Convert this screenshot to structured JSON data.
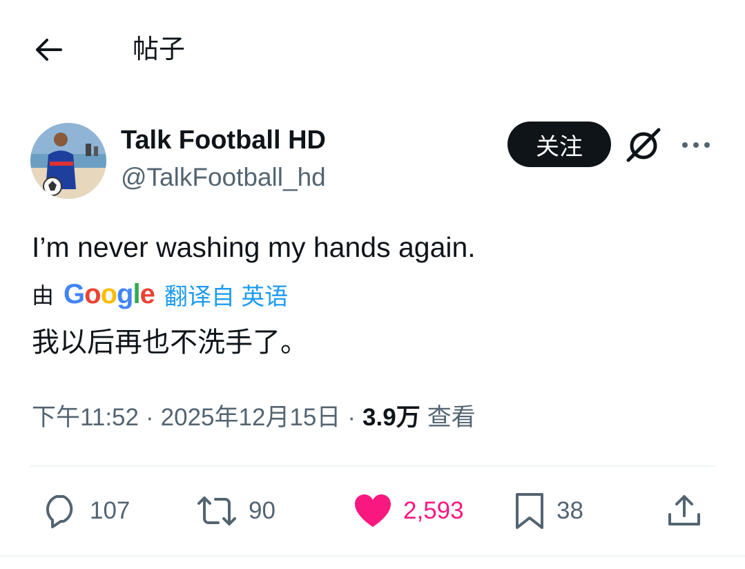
{
  "header": {
    "back_icon": "arrow-left-icon",
    "title": "帖子"
  },
  "author": {
    "display_name": "Talk Football HD",
    "handle": "@TalkFootball_hd",
    "follow_label": "关注"
  },
  "tweet": {
    "text": "I’m never washing my hands again.",
    "translation": {
      "by_label": "由",
      "provider": "Google",
      "translated_from_label": "翻译自 英语",
      "text": "我以后再也不洗手了。"
    },
    "time": "下午11:52",
    "date": "2025年12月15日",
    "separator": "·",
    "views_count": "3.9万",
    "views_label": "查看"
  },
  "stats": {
    "replies": "107",
    "retweets": "90",
    "likes": "2,593",
    "bookmarks": "38"
  },
  "colors": {
    "text": "#0f1419",
    "secondary": "#536471",
    "link": "#1d9bf0",
    "like": "#f91880",
    "follow_bg": "#0f1419"
  },
  "google_colors": [
    "#4285F4",
    "#EA4335",
    "#FBBC05",
    "#4285F4",
    "#34A853",
    "#EA4335"
  ]
}
